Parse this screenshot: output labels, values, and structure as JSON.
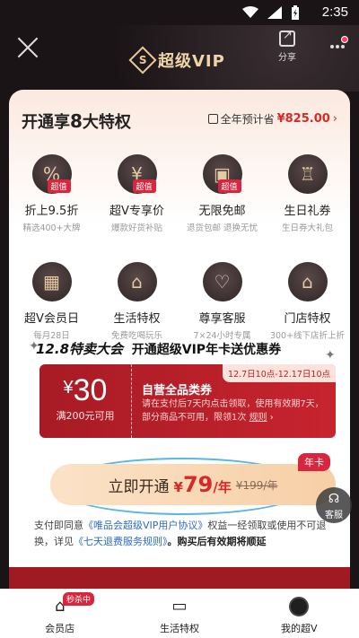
{
  "status_bar": {
    "time": "2:35"
  },
  "header": {
    "brand_glyph": "S",
    "brand_text": "超级VIP",
    "share_label": "分享"
  },
  "card": {
    "title_prefix": "开通享",
    "title_number": "8",
    "title_suffix": "大特权",
    "savings_label": "全年预计省",
    "savings_amount": "¥825.00",
    "perks": [
      {
        "name": "折上9.5折",
        "sub": "精选400+大牌",
        "tag": "超值",
        "icon": "discount-icon"
      },
      {
        "name": "超V专享价",
        "sub": "爆款好货补贴",
        "tag": "超值",
        "icon": "price-tag-icon"
      },
      {
        "name": "无限免邮",
        "sub": "退货包邮 退换无忧",
        "tag": "超值",
        "icon": "truck-icon"
      },
      {
        "name": "生日礼券",
        "sub": "生日券大礼包",
        "tag": "",
        "icon": "cake-icon"
      },
      {
        "name": "超V会员日",
        "sub": "每月28日",
        "tag": "",
        "icon": "calendar-icon"
      },
      {
        "name": "生活特权",
        "sub": "免费吃喝玩乐",
        "tag": "",
        "icon": "shop-icon"
      },
      {
        "name": "尊享客服",
        "sub": "7×24小时专属",
        "tag": "",
        "icon": "headset-icon"
      },
      {
        "name": "门店特权",
        "sub": "300+线下店折上折",
        "tag": "",
        "icon": "store-icon"
      }
    ],
    "promo_head_event": "12.8特卖大会",
    "promo_head_text": "开通超级VIP年卡送优惠券",
    "coupon": {
      "currency": "¥",
      "value": "30",
      "min_spend": "满200元可用",
      "date_range": "12.7日10点-12.17日10点",
      "title": "自营全品类券",
      "desc": "请在支付后7天内点击领取，使用有效期7天，部分商品不可用，限领1次",
      "rules": "规则"
    },
    "cta": {
      "label": "立即开通",
      "price_currency": "¥",
      "price": "79",
      "unit": "/年",
      "original": "¥199/年",
      "badge": "年卡"
    },
    "agreement": {
      "prefix": "支付即同意",
      "link1": "《唯品会超级VIP用户协议》",
      "middle": "权益一经领取或使用不可退换，详见",
      "link2": "《七天退费服务规则》",
      "suffix": "。购买后有效期将顺延"
    },
    "cs_label": "客服"
  },
  "tabbar": {
    "items": [
      {
        "label": "会员店",
        "badge": "秒杀中",
        "icon": "home-icon"
      },
      {
        "label": "生活特权",
        "badge": "",
        "icon": "sofa-icon"
      },
      {
        "label": "我的超V",
        "badge": "",
        "icon": "avatar-icon"
      }
    ]
  },
  "colors": {
    "accent_red": "#d62a2a",
    "gold": "#f0d5a8",
    "link_blue": "#2e6bc4"
  }
}
